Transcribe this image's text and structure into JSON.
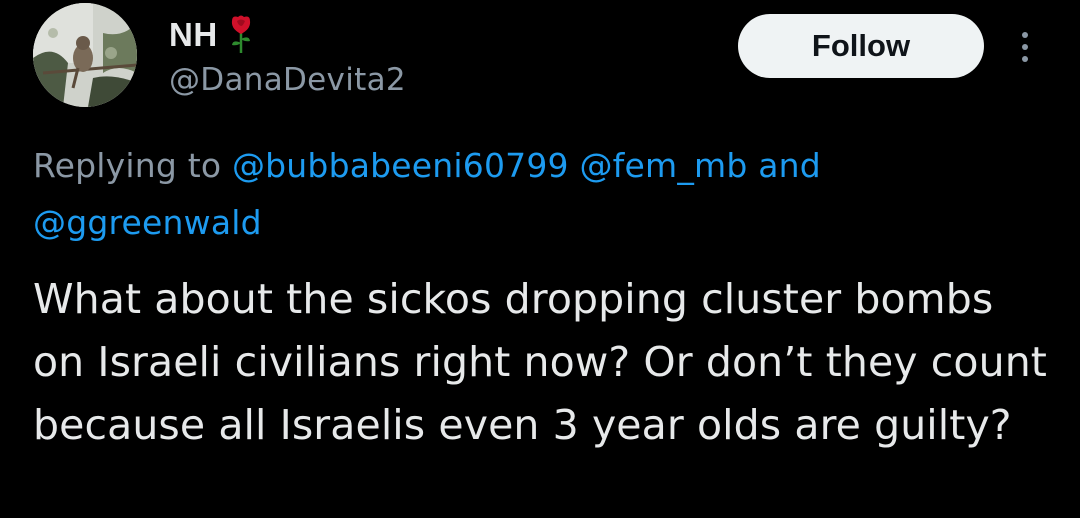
{
  "author": {
    "display_name": "NH",
    "badge_icon": "rose-icon",
    "handle": "@DanaDevita2",
    "avatar_icon": "profile-photo-bird"
  },
  "actions": {
    "follow_label": "Follow",
    "more_icon": "more-vertical-icon"
  },
  "reply_context": {
    "prefix": "Replying to",
    "mentions": [
      "@bubbabeeni60799",
      "@fem_mb",
      "@ggreenwald"
    ],
    "conjunction": "and"
  },
  "tweet": {
    "text": "What about the sickos dropping cluster bombs on Israeli civilians right now? Or don’t they count because all Israelis even 3 year olds are guilty?"
  },
  "colors": {
    "background": "#000000",
    "text_primary": "#e7e9ea",
    "text_secondary": "#8b98a5",
    "link": "#1d9bf0",
    "button_bg": "#eff3f4",
    "button_text": "#0f1419",
    "rose": "#d0102a"
  }
}
